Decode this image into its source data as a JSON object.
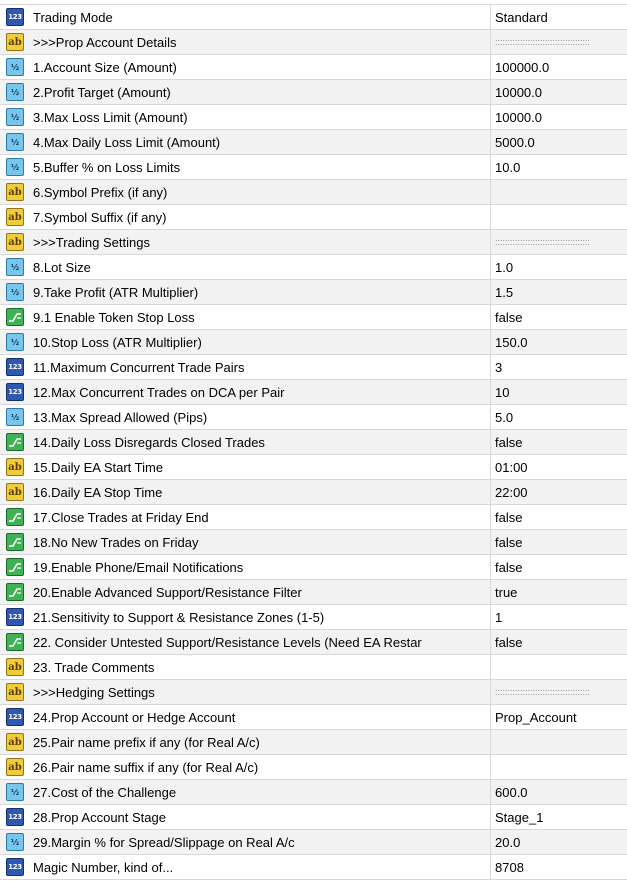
{
  "rows": [
    {
      "type": "int",
      "name": "Trading Mode",
      "value": "Standard"
    },
    {
      "type": "string",
      "name": ">>>Prop Account Details",
      "value": "::::::::::::::::::::::::::::::::::::::"
    },
    {
      "type": "double",
      "name": "1.Account Size (Amount)",
      "value": "100000.0"
    },
    {
      "type": "double",
      "name": "2.Profit Target (Amount)",
      "value": "10000.0"
    },
    {
      "type": "double",
      "name": "3.Max Loss Limit (Amount)",
      "value": "10000.0"
    },
    {
      "type": "double",
      "name": "4.Max Daily Loss Limit (Amount)",
      "value": "5000.0"
    },
    {
      "type": "double",
      "name": "5.Buffer % on Loss Limits",
      "value": "10.0"
    },
    {
      "type": "string",
      "name": "6.Symbol Prefix (if any)",
      "value": ""
    },
    {
      "type": "string",
      "name": "7.Symbol Suffix (if any)",
      "value": ""
    },
    {
      "type": "string",
      "name": ">>>Trading Settings",
      "value": "::::::::::::::::::::::::::::::::::::::"
    },
    {
      "type": "double",
      "name": "8.Lot Size",
      "value": "1.0"
    },
    {
      "type": "double",
      "name": "9.Take Profit (ATR Multiplier)",
      "value": "1.5"
    },
    {
      "type": "bool",
      "name": "9.1 Enable Token Stop Loss",
      "value": "false"
    },
    {
      "type": "double",
      "name": "10.Stop Loss (ATR Multiplier)",
      "value": "150.0"
    },
    {
      "type": "int",
      "name": "11.Maximum Concurrent Trade Pairs",
      "value": "3"
    },
    {
      "type": "int",
      "name": "12.Max Concurrent Trades on DCA per Pair",
      "value": "10"
    },
    {
      "type": "double",
      "name": "13.Max Spread Allowed (Pips)",
      "value": "5.0"
    },
    {
      "type": "bool",
      "name": "14.Daily Loss Disregards Closed Trades",
      "value": "false"
    },
    {
      "type": "string",
      "name": "15.Daily EA Start Time",
      "value": "01:00"
    },
    {
      "type": "string",
      "name": "16.Daily EA Stop Time",
      "value": "22:00"
    },
    {
      "type": "bool",
      "name": "17.Close Trades at Friday End",
      "value": "false"
    },
    {
      "type": "bool",
      "name": "18.No New Trades on Friday",
      "value": "false"
    },
    {
      "type": "bool",
      "name": "19.Enable Phone/Email Notifications",
      "value": "false"
    },
    {
      "type": "bool",
      "name": "20.Enable Advanced Support/Resistance Filter",
      "value": "true"
    },
    {
      "type": "int",
      "name": "21.Sensitivity to Support & Resistance Zones (1-5)",
      "value": "1"
    },
    {
      "type": "bool",
      "name": "22. Consider Untested Support/Resistance Levels (Need EA Restar",
      "value": "false"
    },
    {
      "type": "string",
      "name": "23. Trade Comments",
      "value": ""
    },
    {
      "type": "string",
      "name": ">>>Hedging Settings",
      "value": "::::::::::::::::::::::::::::::::::::::"
    },
    {
      "type": "int",
      "name": "24.Prop Account or Hedge Account",
      "value": "Prop_Account"
    },
    {
      "type": "string",
      "name": "25.Pair name prefix if any (for Real A/c)",
      "value": ""
    },
    {
      "type": "string",
      "name": "26.Pair name suffix if any (for Real A/c)",
      "value": ""
    },
    {
      "type": "double",
      "name": "27.Cost of the Challenge",
      "value": "600.0"
    },
    {
      "type": "int",
      "name": "28.Prop Account Stage",
      "value": "Stage_1"
    },
    {
      "type": "double",
      "name": "29.Margin % for Spread/Slippage on Real A/c",
      "value": "20.0"
    },
    {
      "type": "int",
      "name": "Magic Number, kind of...",
      "value": "8708"
    }
  ],
  "icon_glyphs": {
    "int": "123",
    "string": "ab",
    "double": "½"
  },
  "icon_names": {
    "int": "integer-type-icon",
    "string": "string-type-icon",
    "double": "double-type-icon",
    "bool": "bool-type-icon"
  },
  "colors": {
    "row_alt": "#f2f2f2",
    "gridline": "#d9d9d9",
    "int_icon": "#2f58b3",
    "string_icon": "#f0cc3c",
    "double_icon": "#79c6ec",
    "bool_icon": "#3fb255"
  }
}
